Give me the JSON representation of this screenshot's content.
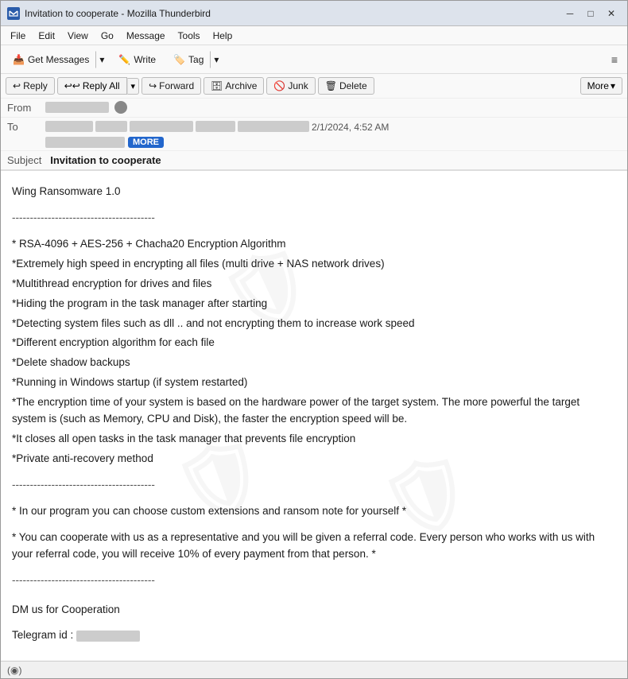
{
  "window": {
    "title": "Invitation to cooperate - Mozilla Thunderbird",
    "icon_label": "T"
  },
  "title_controls": {
    "minimize": "─",
    "maximize": "□",
    "close": "✕"
  },
  "menu": {
    "items": [
      "File",
      "Edit",
      "View",
      "Go",
      "Message",
      "Tools",
      "Help"
    ]
  },
  "toolbar": {
    "get_messages_label": "Get Messages",
    "write_label": "Write",
    "tag_label": "Tag",
    "hamburger": "≡"
  },
  "actions": {
    "reply_label": "Reply",
    "reply_all_label": "Reply All",
    "forward_label": "Forward",
    "archive_label": "Archive",
    "junk_label": "Junk",
    "delete_label": "Delete",
    "more_label": "More"
  },
  "from": {
    "label": "From",
    "address_redacted": true
  },
  "to": {
    "label": "To",
    "more_label": "MORE",
    "date": "2/1/2024, 4:52 AM"
  },
  "subject": {
    "label": "Subject",
    "value": "Invitation to cooperate"
  },
  "body": {
    "title": "Wing Ransomware 1.0",
    "divider": "----------------------------------------",
    "features": [
      "* RSA-4096 + AES-256 + Chacha20 Encryption Algorithm",
      "*Extremely high speed in encrypting all files (multi drive + NAS network drives)",
      "*Multithread encryption for drives and files",
      "*Hiding the program in the task manager after starting",
      "*Detecting system files such as dll .. and not encrypting them to increase work speed",
      "*Different encryption algorithm for each file",
      "*Delete shadow backups",
      "*Running in Windows startup (if system restarted)",
      "*The encryption time of your system is based on the hardware power of the target system. The more powerful the target system is (such as Memory, CPU and Disk), the faster the encryption speed will be.",
      "*It closes all open tasks in the task manager that prevents file encryption",
      "*Private anti-recovery method"
    ],
    "divider2": "----------------------------------------",
    "custom_note": "* In our program you can choose custom extensions and ransom note for yourself *",
    "referral_note": "* You can cooperate with us as a representative and you will be given a referral code. Every person who works with us with your referral code, you will receive 10% of every payment from that person. *",
    "divider3": "----------------------------------------",
    "dm_label": "DM us for Cooperation",
    "telegram_label": "Telegram id :",
    "telegram_redacted": true
  },
  "status_bar": {
    "signal_icon": "(◉)",
    "text": ""
  }
}
